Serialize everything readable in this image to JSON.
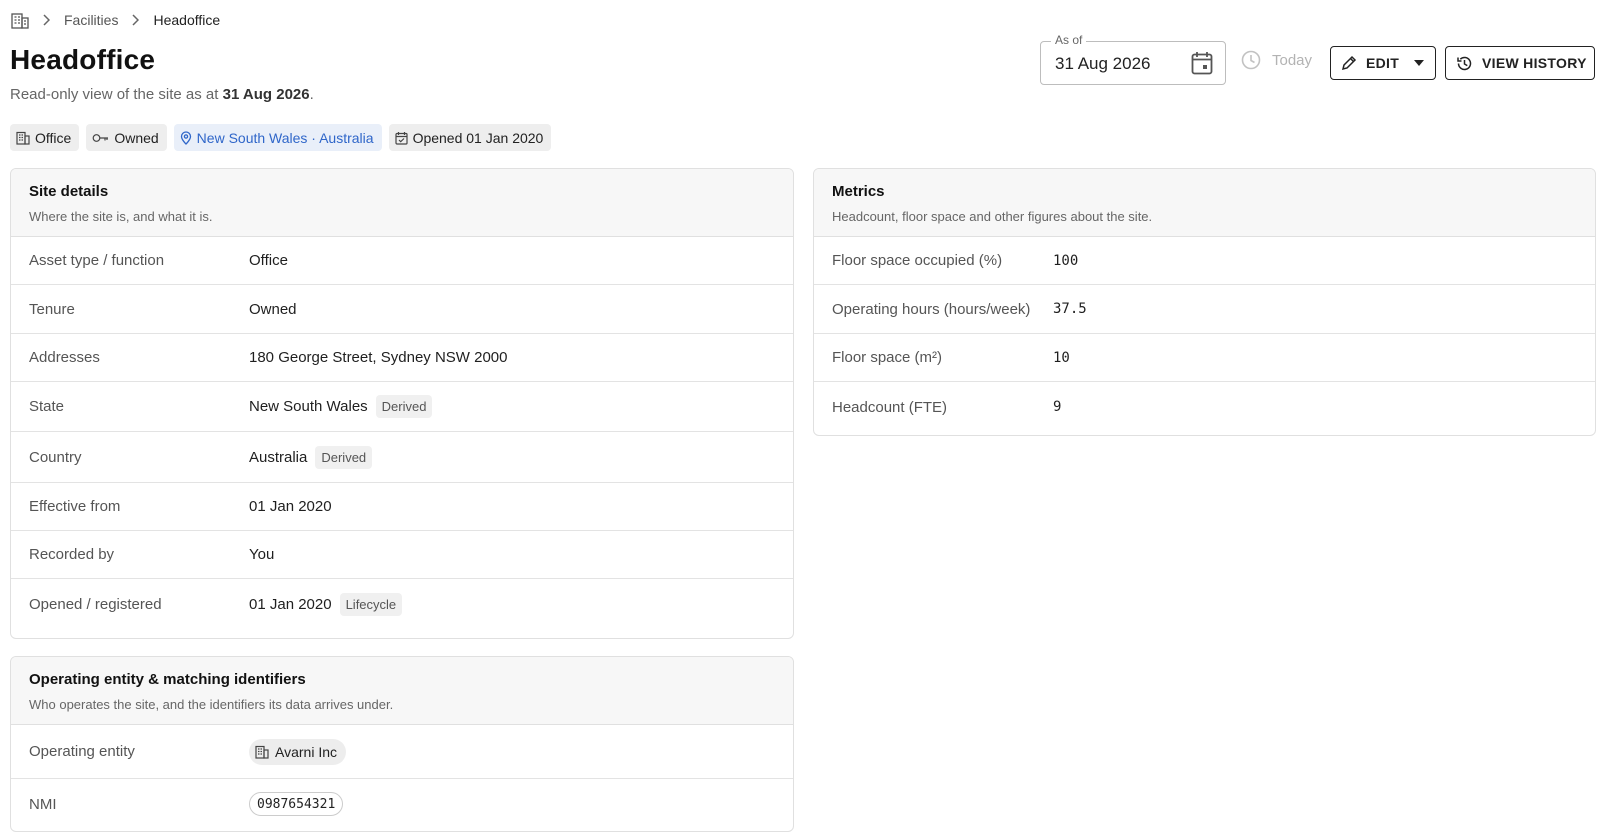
{
  "breadcrumb": {
    "home_icon": "building-icon",
    "items": [
      "Facilities",
      "Headoffice"
    ]
  },
  "header": {
    "title": "Headoffice",
    "subtitle_prefix": "Read-only view of the site as at ",
    "subtitle_date": "31 Aug 2026",
    "subtitle_suffix": "."
  },
  "chips": {
    "asset_type": "Office",
    "tenure": "Owned",
    "location": "New South Wales · Australia",
    "opened": "Opened 01 Jan 2020"
  },
  "as_of": {
    "label": "As of",
    "value": "31 Aug 2026"
  },
  "actions": {
    "today_label": "Today",
    "edit_label": "EDIT",
    "history_label": "VIEW HISTORY"
  },
  "site_details": {
    "title": "Site details",
    "description": "Where the site is, and what it is.",
    "rows": [
      {
        "label": "Asset type / function",
        "value": "Office",
        "tag": ""
      },
      {
        "label": "Tenure",
        "value": "Owned",
        "tag": ""
      },
      {
        "label": "Addresses",
        "value": "180 George Street, Sydney NSW 2000",
        "tag": ""
      },
      {
        "label": "State",
        "value": "New South Wales",
        "tag": "Derived"
      },
      {
        "label": "Country",
        "value": "Australia",
        "tag": "Derived"
      },
      {
        "label": "Effective from",
        "value": "01 Jan 2020",
        "tag": ""
      },
      {
        "label": "Recorded by",
        "value": "You",
        "tag": ""
      },
      {
        "label": "Opened / registered",
        "value": "01 Jan 2020",
        "tag": "Lifecycle"
      }
    ]
  },
  "metrics": {
    "title": "Metrics",
    "description": "Headcount, floor space and other figures about the site.",
    "rows": [
      {
        "label": "Floor space occupied (%)",
        "value": "100"
      },
      {
        "label": "Operating hours (hours/week)",
        "value": "37.5"
      },
      {
        "label": "Floor space (m²)",
        "value": "10"
      },
      {
        "label": "Headcount (FTE)",
        "value": "9"
      }
    ]
  },
  "operating_entity": {
    "title": "Operating entity & matching identifiers",
    "description": "Who operates the site, and the identifiers its data arrives under.",
    "entity_label": "Operating entity",
    "entity_value": "Avarni Inc",
    "nmi_label": "NMI",
    "nmi_value": "0987654321"
  },
  "colors": {
    "accent_blue": "#2f66c9",
    "location_chip_bg": "#e9eff9",
    "disabled_text": "#b3b3b3"
  }
}
